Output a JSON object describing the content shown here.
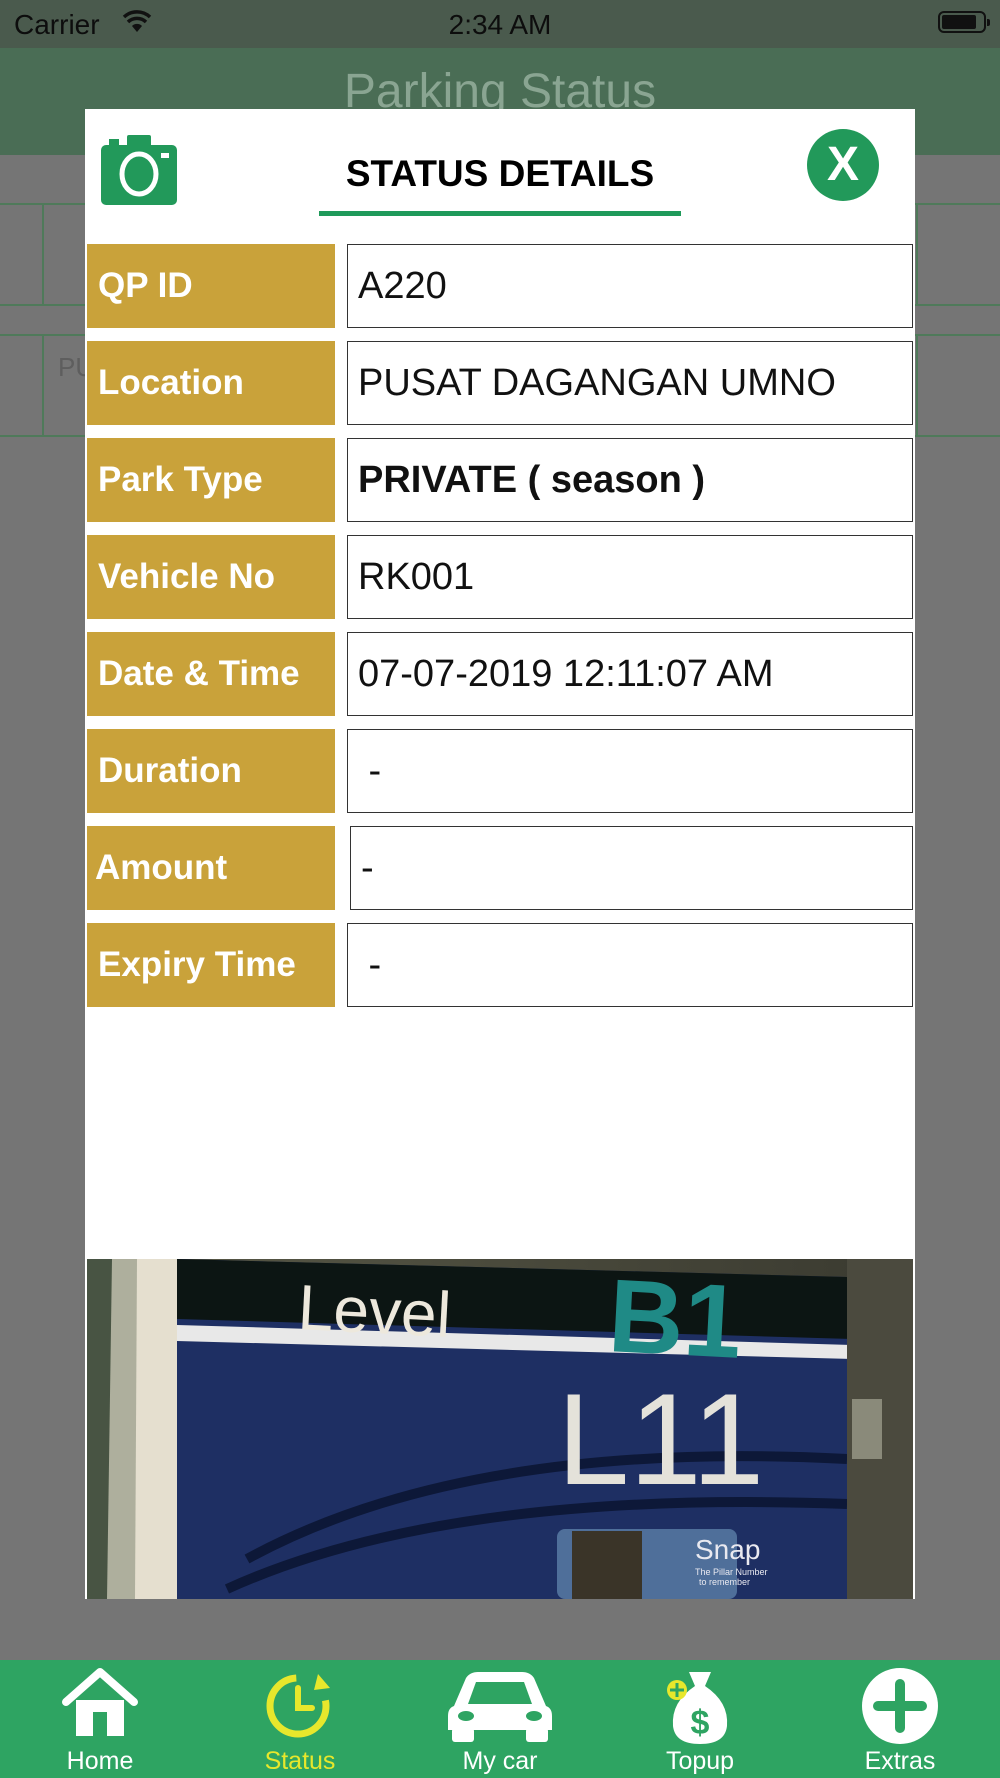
{
  "status_bar": {
    "carrier": "Carrier",
    "time": "2:34 AM",
    "battery_level": 0.85
  },
  "background": {
    "nav_title": "Parking Status",
    "ghost_text": "PU"
  },
  "modal": {
    "title": "STATUS DETAILS",
    "close_label": "X",
    "rows": [
      {
        "label": "QP ID",
        "value": "A220"
      },
      {
        "label": "Location",
        "value": "PUSAT DAGANGAN UMNO"
      },
      {
        "label": "Park Type",
        "value": "PRIVATE ( season )"
      },
      {
        "label": "Vehicle No",
        "value": "RK001"
      },
      {
        "label": "Date & Time",
        "value": "07-07-2019 12:11:07 AM"
      },
      {
        "label": "Duration",
        "value": " -"
      },
      {
        "label": "Amount",
        "value": "-"
      },
      {
        "label": "Expiry Time",
        "value": " -"
      }
    ],
    "photo": {
      "sign_level": "Level",
      "sign_code": "B1",
      "sign_bay": "L11",
      "sign_brand": "Snap",
      "sign_sub1": "The Pillar Number",
      "sign_sub2": "to remember"
    }
  },
  "tabbar": {
    "tabs": [
      {
        "label": "Home",
        "icon": "home-icon"
      },
      {
        "label": "Status",
        "icon": "clock-icon"
      },
      {
        "label": "My car",
        "icon": "car-icon"
      },
      {
        "label": "Topup",
        "icon": "money-bag-icon"
      },
      {
        "label": "Extras",
        "icon": "plus-icon"
      }
    ],
    "active_tab": "Status",
    "active_color": "#e7e72c",
    "bar_color": "#2ea462"
  },
  "colors": {
    "label_bg": "#c9a23a",
    "accent_green": "#22995a"
  }
}
